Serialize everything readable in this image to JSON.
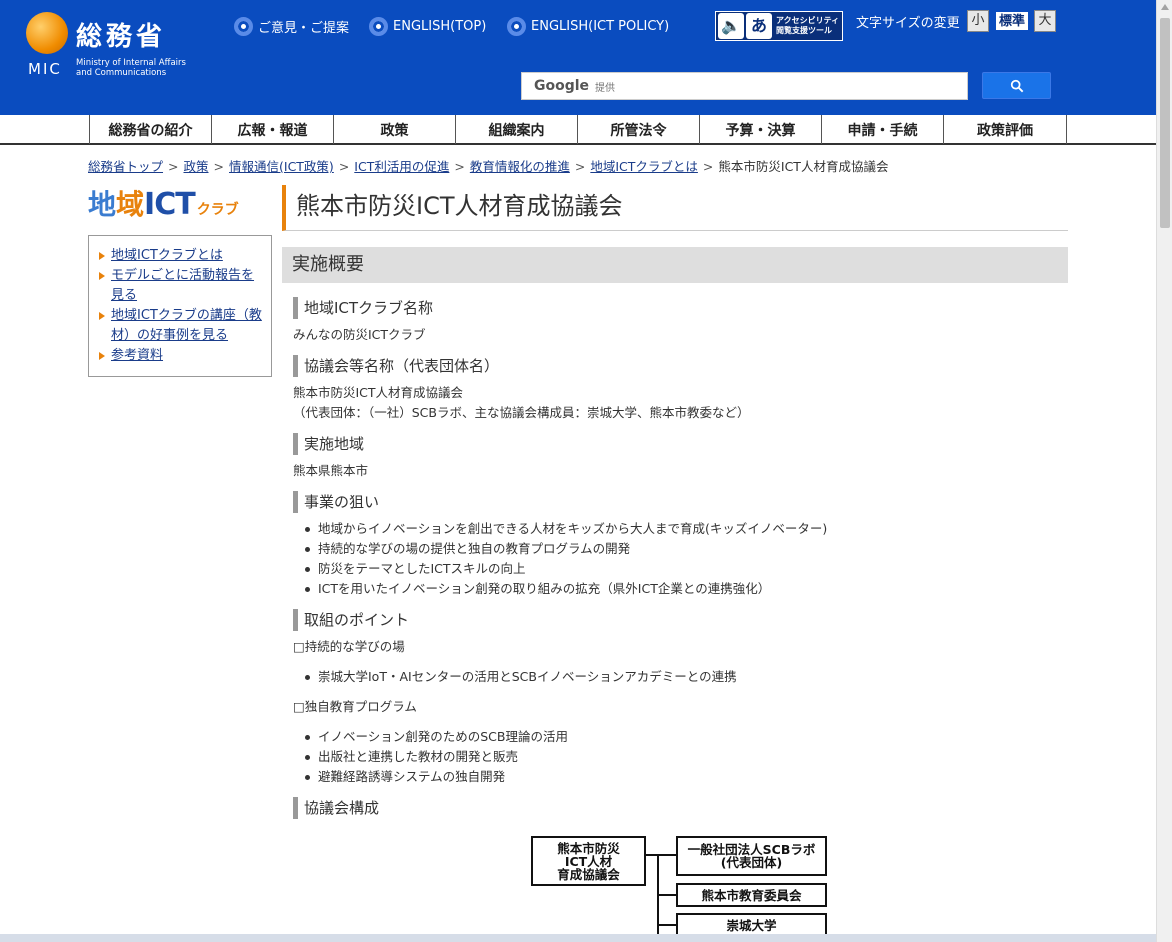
{
  "header": {
    "logo_jp": "総務省",
    "logo_mic": "MIC",
    "logo_en_1": "Ministry of Internal Affairs",
    "logo_en_2": "and Communications",
    "links": [
      "ご意見・ご提案",
      "ENGLISH(TOP)",
      "ENGLISH(ICT POLICY)"
    ],
    "accessibility_line1": "アクセシビリティ",
    "accessibility_line2": "閲覧支援ツール",
    "fontsize_label": "文字サイズの変更",
    "fontsize_small": "小",
    "fontsize_standard": "標準",
    "fontsize_large": "大",
    "search_brand": "Google",
    "search_provided": "提供"
  },
  "nav": {
    "items": [
      "総務省の紹介",
      "広報・報道",
      "政策",
      "組織案内",
      "所管法令",
      "予算・決算",
      "申請・手続",
      "政策評価"
    ]
  },
  "breadcrumb": {
    "items": [
      "総務省トップ",
      "政策",
      "情報通信(ICT政策)",
      "ICT利活用の促進",
      "教育情報化の推進",
      "地域ICTクラブとは"
    ],
    "current": "熊本市防災ICT人材育成協議会"
  },
  "club_logo": {
    "part1": "地",
    "part2": "域",
    "part3": "ICT",
    "part4": "クラブ"
  },
  "sidebar": {
    "items": [
      "地域ICTクラブとは",
      "モデルごとに活動報告を見る",
      "地域ICTクラブの講座（教材）の好事例を見る",
      "参考資料"
    ]
  },
  "main": {
    "title": "熊本市防災ICT人材育成協議会",
    "section": "実施概要",
    "h_club_name": "地域ICTクラブ名称",
    "club_name": "みんなの防災ICTクラブ",
    "h_council": "協議会等名称（代表団体名）",
    "council_name": "熊本市防災ICT人材育成協議会",
    "council_detail": "（代表団体：（一社）SCBラボ、主な協議会構成員：崇城大学、熊本市教委など）",
    "h_region": "実施地域",
    "region": "熊本県熊本市",
    "h_aim": "事業の狙い",
    "aims": [
      "地域からイノベーションを創出できる人材をキッズから大人まで育成(キッズイノベーター)",
      "持続的な学びの場の提供と独自の教育プログラムの開発",
      "防災をテーマとしたICTスキルの向上",
      "ICTを用いたイノベーション創発の取り組みの拡充（県外ICT企業との連携強化）"
    ],
    "h_points": "取組のポイント",
    "point1_title": "□持続的な学びの場",
    "point1_items": [
      "崇城大学IoT・AIセンターの活用とSCBイノベーションアカデミーとの連携"
    ],
    "point2_title": "□独自教育プログラム",
    "point2_items": [
      "イノベーション創発のためのSCB理論の活用",
      "出版社と連携した教材の開発と販売",
      "避難経路誘導システムの独自開発"
    ],
    "h_structure": "協議会構成"
  },
  "org": {
    "root_line1": "熊本市防災",
    "root_line2": "ICT人材",
    "root_line3": "育成協議会",
    "member1_line1": "一般社団法人SCBラボ",
    "member1_line2": "(代表団体)",
    "member2": "熊本市教育委員会",
    "member3": "崇城大学"
  },
  "colors": {
    "header_blue": "#0a4cbf",
    "accent_orange": "#e8820c",
    "link_blue": "#1a3c8a"
  }
}
